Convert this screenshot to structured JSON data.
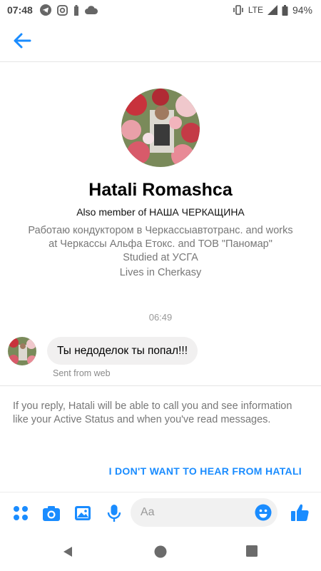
{
  "status_bar": {
    "time": "07:48",
    "network": "LTE",
    "battery": "94%",
    "icons": [
      "telegram-icon",
      "instagram-icon",
      "battery-saver-icon",
      "cloud-icon",
      "vibrate-icon",
      "signal-icon",
      "battery-icon"
    ]
  },
  "header": {
    "back_icon": "arrow-left-icon"
  },
  "profile": {
    "name": "Hatali Romashca",
    "member_of": "Also member of НАША ЧЕРКАЩИНА",
    "work_line1": "Работаю кондуктором в Черкассыавтотранс. and works",
    "work_line2": "at Черкассы Альфа Етокс. and ТОВ \"Паномар\"",
    "studied": "Studied at УСГА",
    "lives": "Lives in Cherkasy"
  },
  "conversation": {
    "timestamp": "06:49",
    "messages": [
      {
        "text": "Ты недоделок ты попал!!!",
        "meta": "Sent from web"
      }
    ]
  },
  "notice": {
    "text": "If you reply, Hatali will be able to call you and see information like your Active Status and when you've read messages.",
    "action": "I DON'T WANT TO HEAR FROM HATALI"
  },
  "composer": {
    "placeholder": "Aa",
    "icons": [
      "apps-icon",
      "camera-icon",
      "gallery-icon",
      "mic-icon",
      "emoji-icon",
      "thumbs-up-icon"
    ]
  },
  "colors": {
    "accent": "#1a8cff",
    "bubble": "#f1f0f0",
    "secondary_text": "#777777"
  },
  "nav_bar": {
    "icons": [
      "back-triangle-icon",
      "home-circle-icon",
      "recents-square-icon"
    ]
  }
}
